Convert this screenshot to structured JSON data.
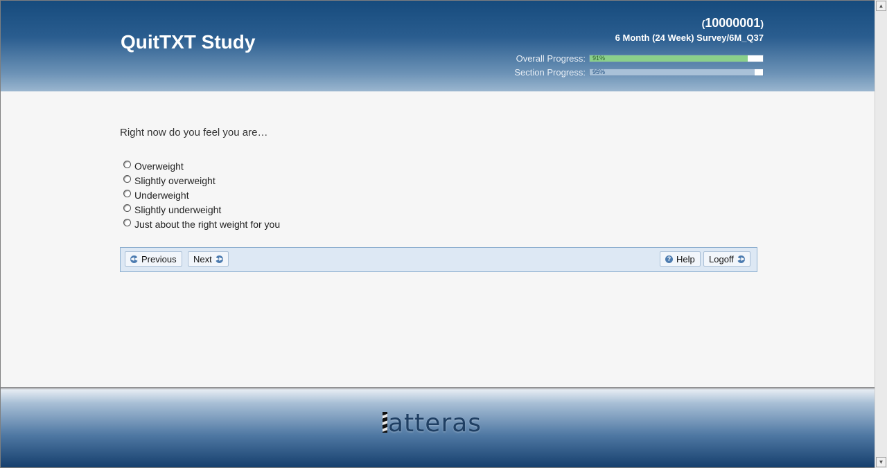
{
  "header": {
    "title": "QuitTXT Study",
    "participant_id": "10000001",
    "paren_open": "(",
    "paren_close": ")",
    "survey_path": "6 Month (24 Week) Survey/6M_Q37",
    "overall_label": "Overall Progress:",
    "overall_percent_text": "91%",
    "overall_fraction": 0.91,
    "section_label": "Section Progress:",
    "section_percent_text": "95%",
    "section_fraction": 0.95
  },
  "question": {
    "text": "Right now do you feel you are…",
    "options": [
      "Overweight",
      "Slightly overweight",
      "Underweight",
      "Slightly underweight",
      "Just about the right weight for you"
    ]
  },
  "nav": {
    "previous_label": "Previous",
    "next_label": "Next",
    "help_label": "Help",
    "logoff_label": "Logoff"
  },
  "footer": {
    "logo_text": "atteras"
  }
}
